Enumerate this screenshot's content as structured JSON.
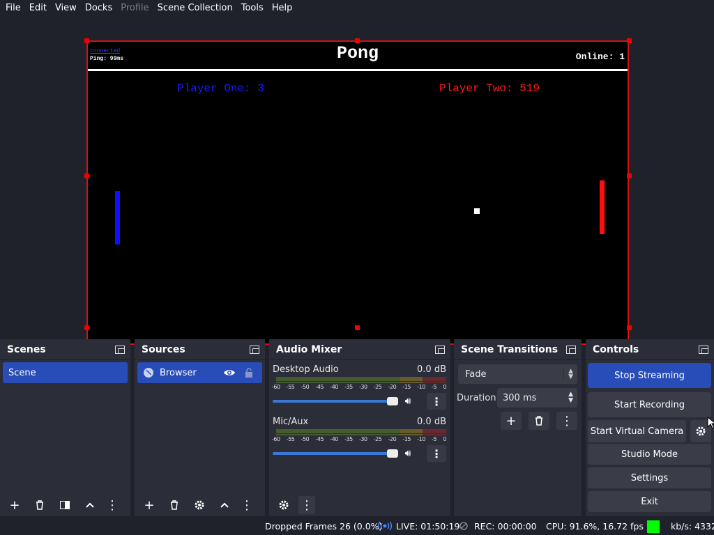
{
  "menu": [
    "File",
    "Edit",
    "View",
    "Docks",
    "Profile",
    "Scene Collection",
    "Tools",
    "Help"
  ],
  "preview": {
    "link_text": "connected",
    "ping": "Ping: 99ms",
    "title": "Pong",
    "online": "Online: 1",
    "player_one": "Player One: 3",
    "player_two": "Player Two: 519"
  },
  "scenes": {
    "title": "Scenes",
    "items": [
      "Scene"
    ]
  },
  "sources": {
    "title": "Sources",
    "items": [
      "Browser"
    ]
  },
  "mixer": {
    "title": "Audio Mixer",
    "ticks": [
      "-60",
      "-55",
      "-50",
      "-45",
      "-40",
      "-35",
      "-30",
      "-25",
      "-20",
      "-15",
      "-10",
      "-5",
      "0"
    ],
    "channels": [
      {
        "name": "Desktop Audio",
        "level": "0.0 dB",
        "volume": 1.0
      },
      {
        "name": "Mic/Aux",
        "level": "0.0 dB",
        "volume": 1.0
      }
    ]
  },
  "transitions": {
    "title": "Scene Transitions",
    "selected": "Fade",
    "duration_label": "Duration",
    "duration_value": "300 ms"
  },
  "controls": {
    "title": "Controls",
    "stop_streaming": "Stop Streaming",
    "start_recording": "Start Recording",
    "start_virtual_camera": "Start Virtual Camera",
    "studio_mode": "Studio Mode",
    "settings": "Settings",
    "exit": "Exit"
  },
  "status": {
    "dropped_frames": "Dropped Frames 26 (0.0%)",
    "live": "LIVE: 01:50:19",
    "rec": "REC: 00:00:00",
    "cpu": "CPU: 91.6%, 16.72 fps",
    "kbs": "kb/s: 4332"
  },
  "colors": {
    "accent": "#284cb8",
    "player_one": "#1a1aff",
    "player_two": "#ff1a1a",
    "selection_border": "#d51010",
    "status_ok": "#00ff00"
  }
}
